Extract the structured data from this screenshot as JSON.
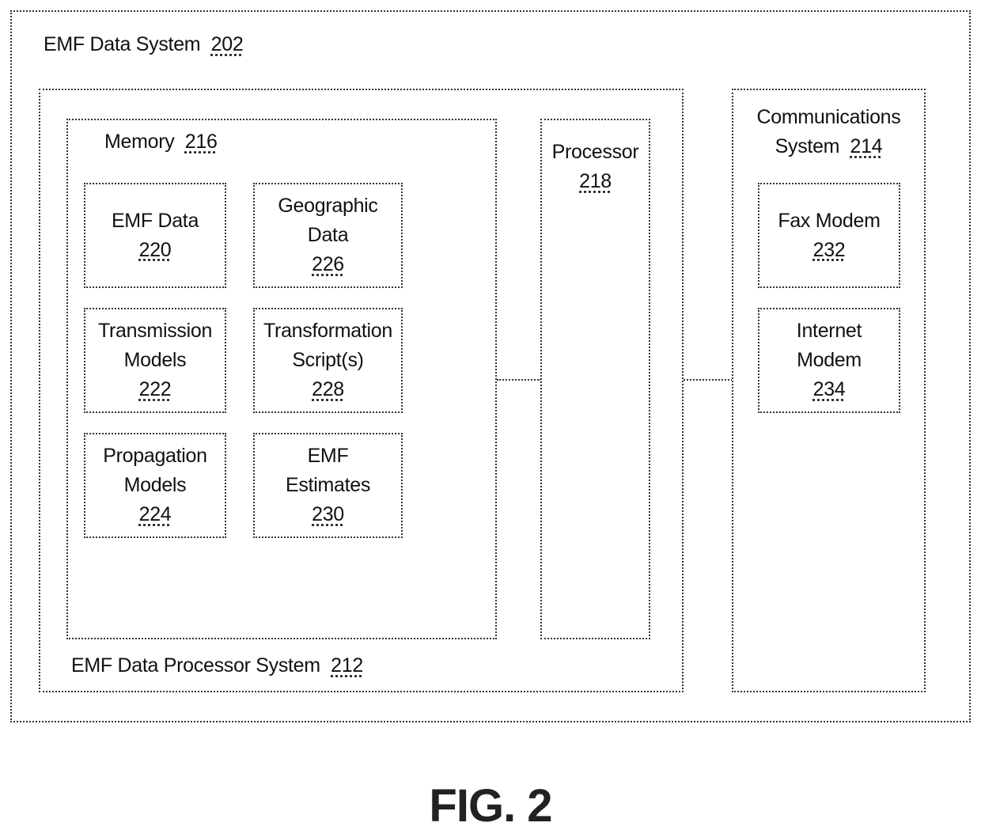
{
  "figure_label": "FIG. 2",
  "emf_data_system": {
    "title": "EMF Data System",
    "ref": "202"
  },
  "processor_system": {
    "title": "EMF Data Processor System",
    "ref": "212"
  },
  "memory": {
    "title": "Memory",
    "ref": "216",
    "items": [
      {
        "lines": [
          "EMF Data"
        ],
        "ref": "220"
      },
      {
        "lines": [
          "Geographic",
          "Data"
        ],
        "ref": "226"
      },
      {
        "lines": [
          "Transmission",
          "Models"
        ],
        "ref": "222"
      },
      {
        "lines": [
          "Transformation",
          "Script(s)"
        ],
        "ref": "228"
      },
      {
        "lines": [
          "Propagation",
          "Models"
        ],
        "ref": "224"
      },
      {
        "lines": [
          "EMF",
          "Estimates"
        ],
        "ref": "230"
      }
    ]
  },
  "processor": {
    "title": "Processor",
    "ref": "218"
  },
  "communications": {
    "title_line1": "Communications",
    "title_line2": "System",
    "ref": "214",
    "items": [
      {
        "lines": [
          "Fax Modem"
        ],
        "ref": "232"
      },
      {
        "lines": [
          "Internet",
          "Modem"
        ],
        "ref": "234"
      }
    ]
  }
}
